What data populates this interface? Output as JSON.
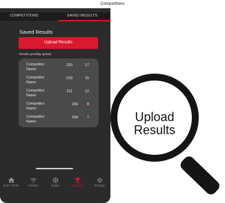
{
  "caption": "Competitions",
  "tabs": [
    {
      "label": "COMPETITIONS"
    },
    {
      "label": "SAVED RESULTS"
    }
  ],
  "saved_results": {
    "title": "Saved Results",
    "upload_button": "Upload Results",
    "pending_label": "Results pending upload",
    "rows": [
      {
        "name": "Competitor Name",
        "score": "220",
        "x_count": "17"
      },
      {
        "name": "Competitor Name",
        "score": "218",
        "x_count": "15"
      },
      {
        "name": "Competitor Name",
        "score": "211",
        "x_count": "12"
      },
      {
        "name": "Competitor Name",
        "score": "209",
        "x_count": "8"
      },
      {
        "name": "Competitor Name",
        "score": "208",
        "x_count": "7"
      }
    ]
  },
  "bottom_nav": [
    {
      "label": "ELEY InSite",
      "icon": "home-icon"
    },
    {
      "label": "Contact",
      "icon": "wifi-icon"
    },
    {
      "label": "Scope",
      "icon": "scope-icon"
    },
    {
      "label": "Compete",
      "icon": "trophy-icon",
      "active": true
    },
    {
      "label": "Settings",
      "icon": "gear-icon"
    }
  ],
  "magnifier": {
    "text": "Upload Results"
  },
  "colors": {
    "accent": "#d9192e",
    "phone_bg": "#2b2b2b",
    "panel_bg": "#4a4a4a"
  }
}
